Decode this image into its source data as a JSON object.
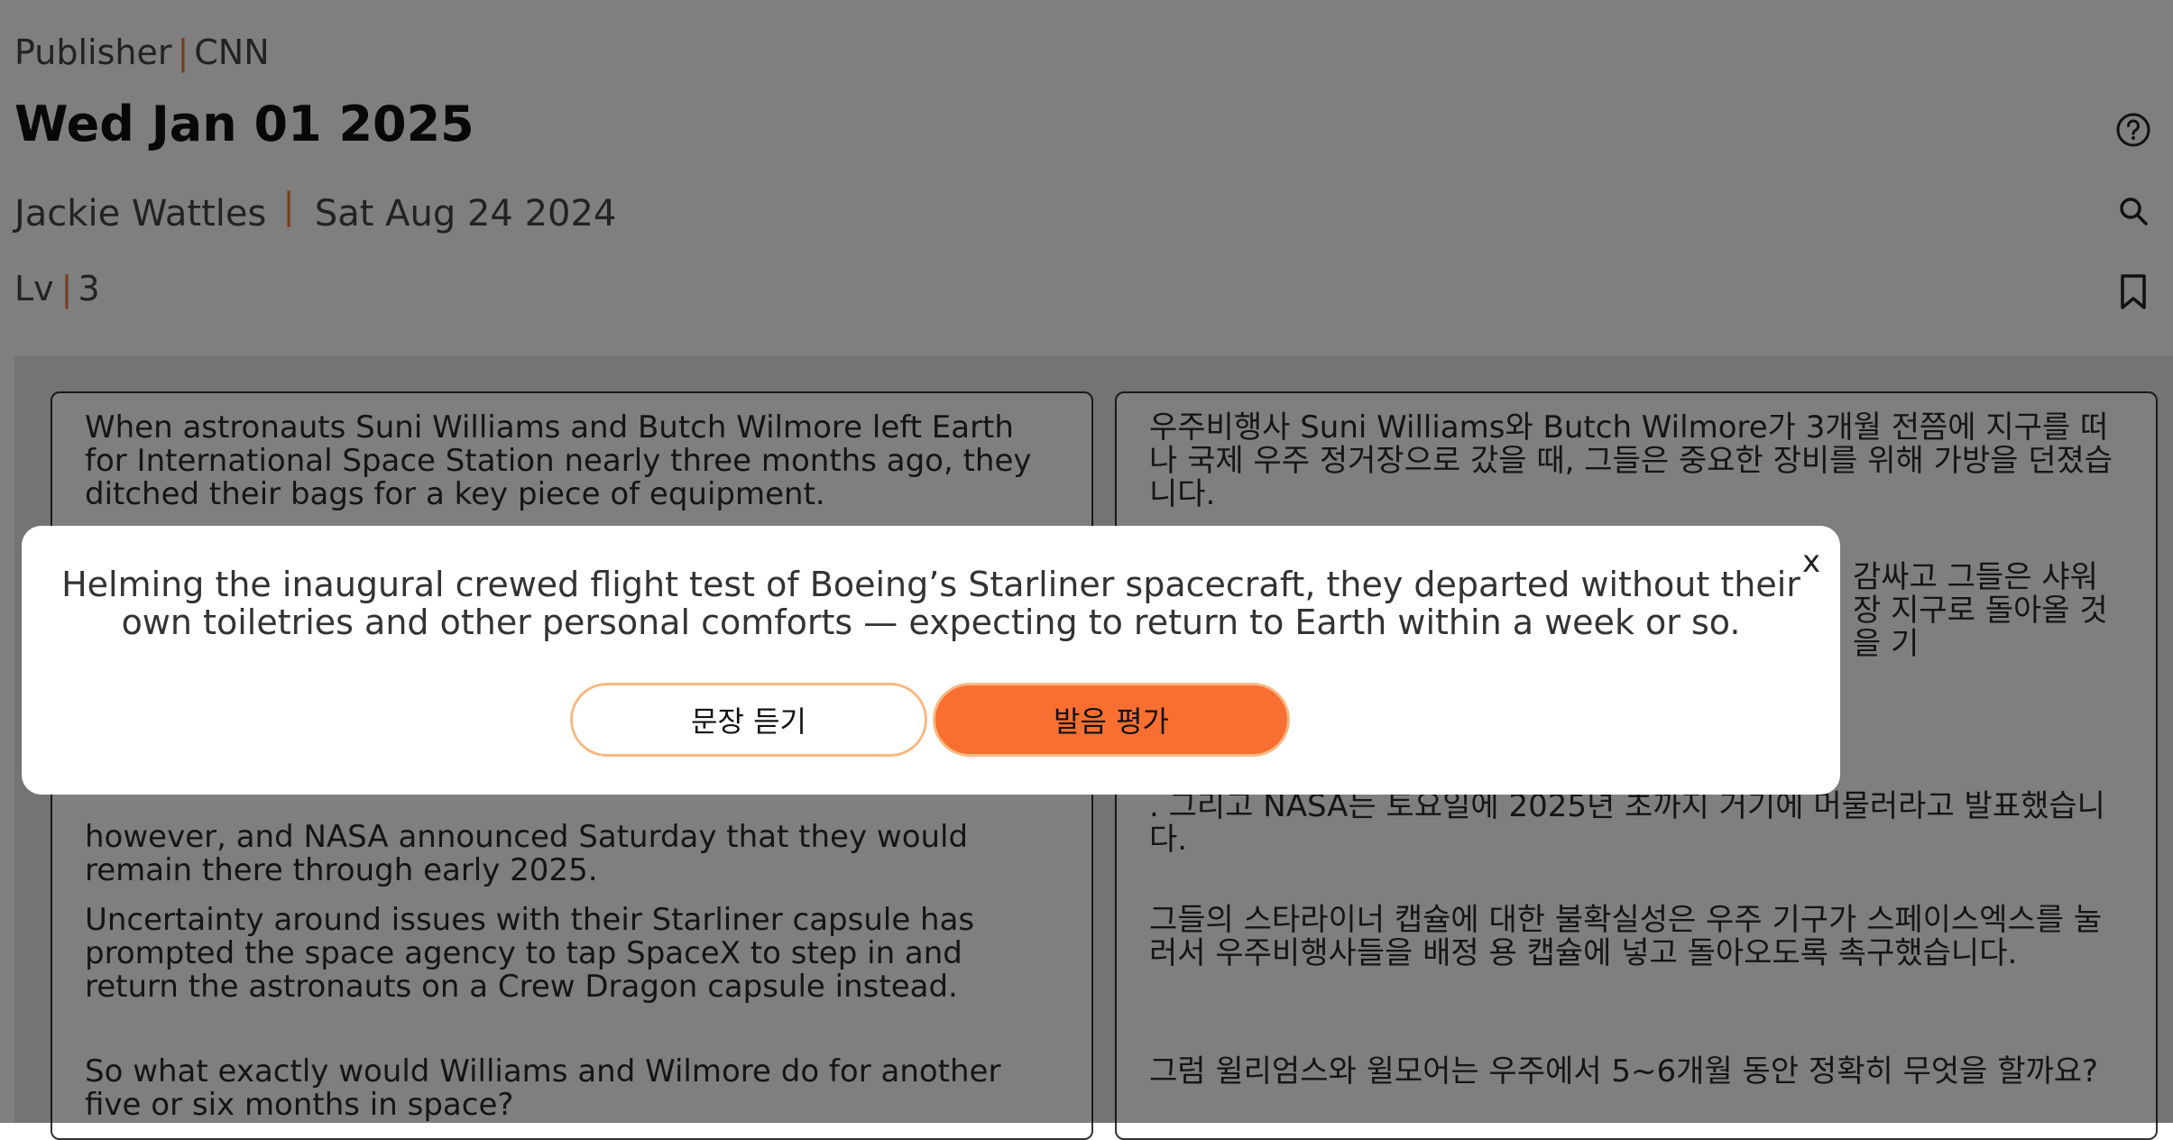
{
  "header": {
    "publisher_label": "Publisher",
    "publisher_name": "CNN",
    "date": "Wed Jan 01 2025",
    "author": "Jackie Wattles",
    "published_date": "Sat Aug 24 2024",
    "level_label": "Lv",
    "level_value": "3",
    "separator": "|"
  },
  "icons": {
    "help": "help-circle-icon",
    "search": "search-icon",
    "bookmark": "bookmark-icon"
  },
  "article": {
    "english": [
      "When astronauts Suni Williams and Butch Wilmore left Earth for International Space Station nearly three months ago, they ditched their bags for a key piece of equipment.",
      "however, and NASA announced Saturday that they would remain there through early 2025.",
      "Uncertainty around issues with their Starliner capsule has prompted the space agency to tap SpaceX to step in and return the astronauts on a Crew Dragon capsule instead.",
      "So what exactly would Williams and Wilmore do for another five or six months in space?"
    ],
    "korean": [
      "우주비행사 Suni Williams와 Butch Wilmore가 3개월 전쯤에 지구를 떠나 국제 우주 정거장으로 갔을 때, 그들은 중요한 장비를 위해 가방을 던졌습니다.",
      "감싸고 그들은 샤워장 지구로 돌아올 것을 기",
      ". 그리고 NASA는 토요일에 2025년 초까지 거기에 머물러라고 발표했습니다.",
      "그들의 스타라이너 캡슐에 대한 불확실성은 우주 기구가 스페이스엑스를 눌러서 우주비행사들을 배정 용 캡슐에 넣고 돌아오도록 촉구했습니다.",
      "그럼 윌리엄스와 윌모어는 우주에서 5~6개월 동안 정확히 무엇을 할까요?"
    ]
  },
  "modal": {
    "close_label": "x",
    "sentence": "Helming the inaugural crewed flight test of Boeing’s Starliner spacecraft, they departed without their own toiletries and other personal comforts — expecting to return to Earth within a week or so.",
    "listen_button": "문장 듣기",
    "evaluate_button": "발음 평가"
  },
  "colors": {
    "accent": "#f86f31",
    "accent_light": "#f7b982",
    "separator": "#f07a3a"
  }
}
